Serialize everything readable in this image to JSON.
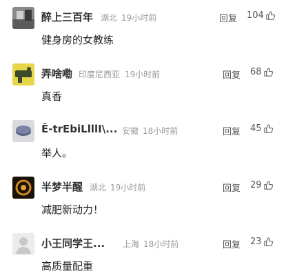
{
  "comments": [
    {
      "name": "醉上三百年",
      "region": "湖北",
      "time": "19小时前",
      "reply_label": "回复",
      "likes": "104",
      "text": "健身房的女教练"
    },
    {
      "name": "弄啥嘞",
      "region": "印度尼西亚",
      "time": "19小时前",
      "reply_label": "回复",
      "likes": "68",
      "text": "真香"
    },
    {
      "name": "Ê-trEbiLlllI\\...",
      "region": "安徽",
      "time": "18小时前",
      "reply_label": "回复",
      "likes": "45",
      "text": "举人。"
    },
    {
      "name": "半梦半醒",
      "region": "湖北",
      "time": "19小时前",
      "reply_label": "回复",
      "likes": "29",
      "text": "减肥新动力！"
    },
    {
      "name": "小王同学王...",
      "region": "上海",
      "time": "18小时前",
      "reply_label": "回复",
      "likes": "23",
      "text": "高质量配重"
    }
  ]
}
